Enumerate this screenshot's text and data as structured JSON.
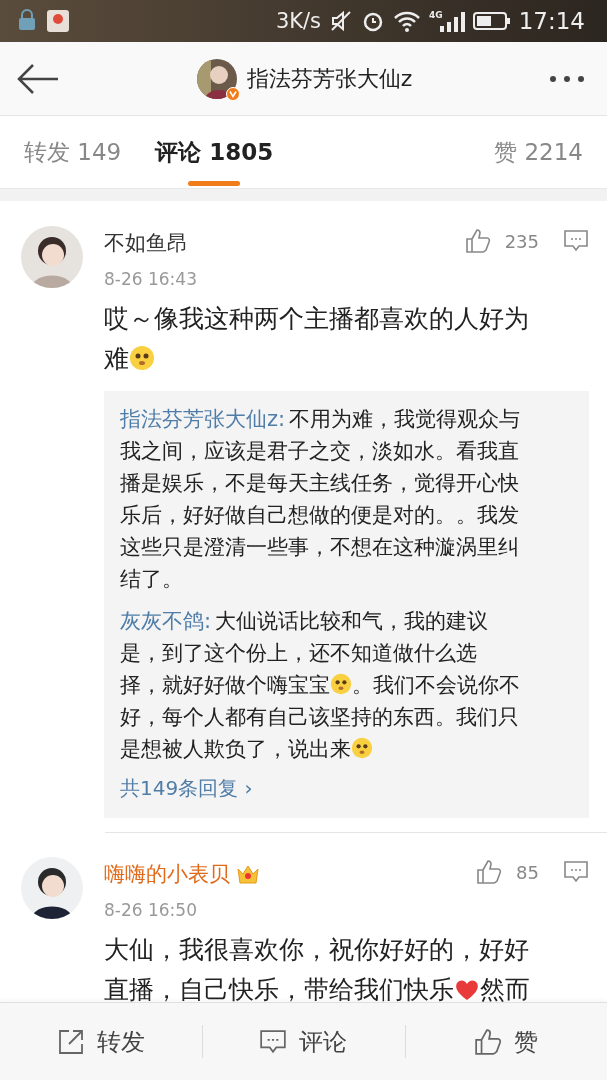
{
  "status_bar": {
    "speed": "3K/s",
    "network": "4G",
    "time": "17:14"
  },
  "header": {
    "title": "指法芬芳张大仙z"
  },
  "tabs": [
    {
      "label": "转发 149",
      "selected": false
    },
    {
      "label": "评论 1805",
      "selected": true
    },
    {
      "label": "赞 2214",
      "selected": false
    }
  ],
  "comments": [
    {
      "name": "不如鱼昂",
      "vip": false,
      "time": "8-26 16:43",
      "likes": "235",
      "lines": [
        [
          {
            "kind": "text",
            "text": "哎～像我这种两个主播都喜欢的人好为"
          }
        ],
        [
          {
            "kind": "text",
            "text": "难"
          },
          {
            "kind": "emoji"
          }
        ]
      ],
      "replies": {
        "items": [
          {
            "lines": [
              [
                {
                  "kind": "author",
                  "text": "指法芬芳张大仙z:"
                },
                {
                  "kind": "text",
                  "text": "不用为难，我觉得观众与"
                }
              ],
              [
                {
                  "kind": "text",
                  "text": "我之间，应该是君子之交，淡如水。看我直"
                }
              ],
              [
                {
                  "kind": "text",
                  "text": "播是娱乐，不是每天主线任务，觉得开心快"
                }
              ],
              [
                {
                  "kind": "text",
                  "text": "乐后，好好做自己想做的便是对的。。我发"
                }
              ],
              [
                {
                  "kind": "text",
                  "text": "这些只是澄清一些事，不想在这种漩涡里纠"
                }
              ],
              [
                {
                  "kind": "text",
                  "text": "结了。"
                }
              ]
            ]
          },
          {
            "lines": [
              [
                {
                  "kind": "author",
                  "text": "灰灰不鸽:"
                },
                {
                  "kind": "text",
                  "text": "大仙说话比较和气，我的建议"
                }
              ],
              [
                {
                  "kind": "text",
                  "text": "是，到了这个份上，还不知道做什么选"
                }
              ],
              [
                {
                  "kind": "text",
                  "text": "择，就好好做个嗨宝宝"
                },
                {
                  "kind": "emoji"
                },
                {
                  "kind": "text",
                  "text": "。我们不会说你不"
                }
              ],
              [
                {
                  "kind": "text",
                  "text": "好，每个人都有自己该坚持的东西。我们只"
                }
              ],
              [
                {
                  "kind": "text",
                  "text": "是想被人欺负了，说出来"
                },
                {
                  "kind": "emoji"
                }
              ]
            ]
          }
        ],
        "more": "共149条回复 ›"
      }
    },
    {
      "name": "嗨嗨的小表贝",
      "vip": true,
      "time": "8-26 16:50",
      "likes": "85",
      "lines": [
        [
          {
            "kind": "text",
            "text": "大仙，我很喜欢你，祝你好好的，好好"
          }
        ],
        [
          {
            "kind": "text",
            "text": "直播，自己快乐，带给我们快乐"
          },
          {
            "kind": "heart"
          },
          {
            "kind": "text",
            "text": "然而"
          }
        ]
      ]
    }
  ],
  "bottom_bar": [
    {
      "kind": "repost",
      "label": "转发"
    },
    {
      "kind": "comment",
      "label": "评论"
    },
    {
      "kind": "like",
      "label": "赞"
    }
  ]
}
